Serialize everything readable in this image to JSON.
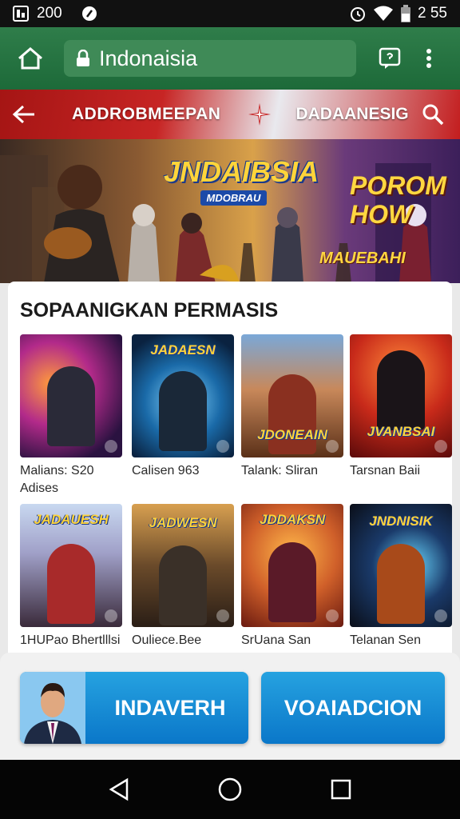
{
  "status": {
    "time_left": "200",
    "time_right": "2 55"
  },
  "browser": {
    "url": "Indonaisia"
  },
  "site_nav": {
    "title_left": "ADDROBMEEPAN",
    "title_right": "DADAANESIG"
  },
  "hero": {
    "logo_main": "JNDAIBSIA",
    "logo_sub": "MDOBRAU",
    "promo_line1": "POROM",
    "promo_line2": "HOW",
    "promo_line3": "MAUEBAHI"
  },
  "section": {
    "title": "SOPAANIGKAN PERMASIS"
  },
  "games": [
    {
      "name": "Malians: S20 Adises",
      "logo": ""
    },
    {
      "name": "Calisen 963",
      "logo": "JADAESN"
    },
    {
      "name": "Talank: Sliran",
      "logo": "JDONEAIN"
    },
    {
      "name": "Tarsnan Baii",
      "logo": "JVANBSAI"
    },
    {
      "name": "1HUPao Bhertlllsi",
      "logo": "JADAUESH"
    },
    {
      "name": "Ouliece.Bee",
      "logo": "JADWESN"
    },
    {
      "name": "SrUana San",
      "logo": "JDDAKSN"
    },
    {
      "name": "Telanan Sen",
      "logo": "JNDNISIK"
    }
  ],
  "cta": {
    "left_label": "INDAVERH",
    "right_label": "VOAIADCION"
  },
  "colors": {
    "browser_bar": "#2f7d4a",
    "cta_blue": "#1a8ed6",
    "nav_red": "#c72524"
  }
}
